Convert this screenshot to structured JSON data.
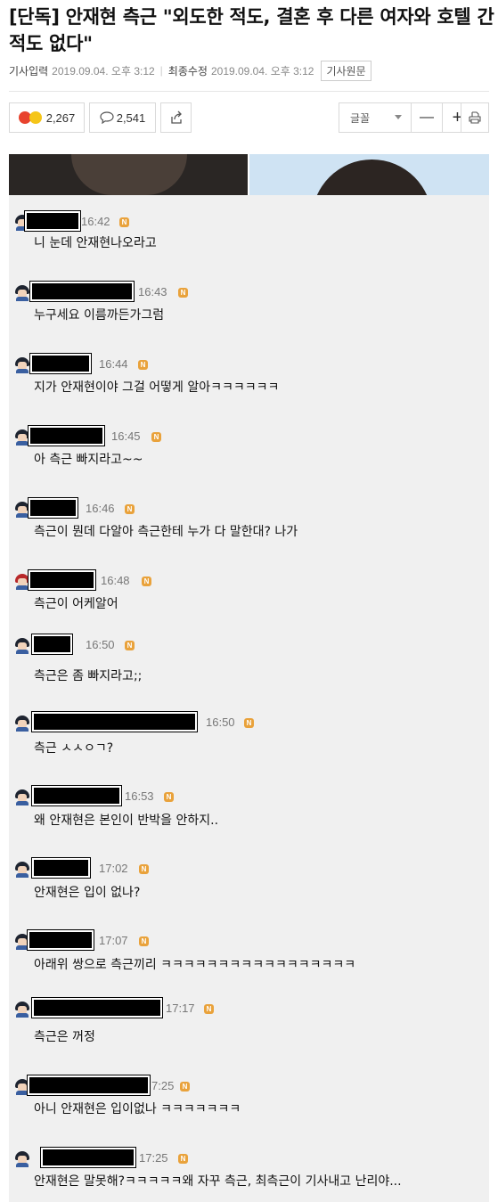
{
  "article": {
    "title": "[단독] 안재현 측근 \"외도한 적도, 결혼 후 다른 여자와 호텔 간 적도 없다\"",
    "input_label": "기사입력",
    "input_time": "2019.09.04. 오후 3:12",
    "modified_label": "최종수정",
    "modified_time": "2019.09.04. 오후 3:12",
    "original_button": "기사원문"
  },
  "toolbar": {
    "reaction_count": "2,267",
    "comment_count": "2,541",
    "font_label": "글꼴",
    "minus_label": "—",
    "plus_label": "+"
  },
  "comments": [
    {
      "time": "16:42",
      "text": "니 눈데 안재현나오라고",
      "badge": "N"
    },
    {
      "time": "16:43",
      "text": "누구세요 이름까든가그럼",
      "badge": "N"
    },
    {
      "time": "16:44",
      "text": "지가 안재현이야 그걸 어떻게 알아ㅋㅋㅋㅋㅋㅋ",
      "badge": "N"
    },
    {
      "time": "16:45",
      "text": "아 측근 빠지라고~~",
      "badge": "N"
    },
    {
      "time": "16:46",
      "text": "측근이 뭔데 다알아 측근한테 누가 다 말한대? 나가",
      "badge": "N"
    },
    {
      "time": "16:48",
      "text": "측근이 어케알어",
      "badge": "N"
    },
    {
      "time": "16:50",
      "text": "측근은 좀 빠지라고;;",
      "badge": "N"
    },
    {
      "time": "16:50",
      "text": "측근 ㅅㅅㅇㄱ?",
      "badge": "N"
    },
    {
      "time": "16:53",
      "text": "왜 안재현은 본인이 반박을 안하지..",
      "badge": "N"
    },
    {
      "time": "17:02",
      "text": "안재현은 입이 없나?",
      "badge": "N"
    },
    {
      "time": "17:07",
      "text": "아래위 쌍으로 측근끼리 ㅋㅋㅋㅋㅋㅋㅋㅋㅋㅋㅋㅋㅋㅋㅋㅋㅋ",
      "badge": "N"
    },
    {
      "time": "17:17",
      "text": "측근은 꺼정",
      "badge": "N"
    },
    {
      "time": "7:25",
      "text": "아니 안재현은 입이없나 ㅋㅋㅋㅋㅋㅋㅋ",
      "badge": "N"
    },
    {
      "time": "17:25",
      "text": "안재현은 말못해?ㅋㅋㅋㅋㅋ왜 자꾸 측근, 최측근이 기사내고 난리야...",
      "badge": "N"
    }
  ]
}
